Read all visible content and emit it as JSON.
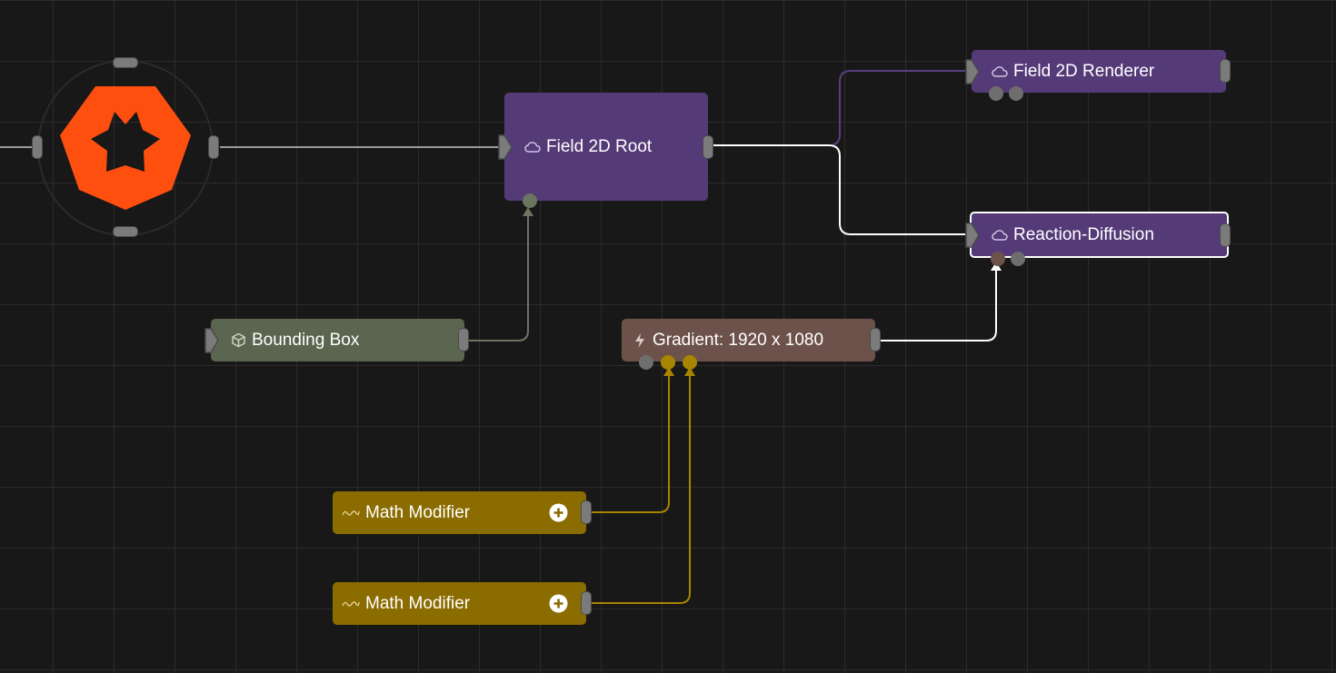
{
  "app": {
    "theme": {
      "background": "#181818",
      "grid": "#2b2b2b",
      "brand": "#ff4f0f"
    }
  },
  "root_node": {
    "icon": "brand-logo-icon"
  },
  "nodes": {
    "field_root": {
      "label": "Field 2D Root",
      "icon": "cloud-icon",
      "color": "#553a78"
    },
    "renderer": {
      "label": "Field 2D Renderer",
      "icon": "cloud-icon",
      "color": "#553a78"
    },
    "reaction": {
      "label": "Reaction-Diffusion",
      "icon": "cloud-icon",
      "color": "#553a78",
      "selected": true
    },
    "bounding": {
      "label": "Bounding Box",
      "icon": "cube-icon",
      "color": "#5b6650"
    },
    "gradient": {
      "label": "Gradient: 1920 x 1080",
      "icon": "lightning-icon",
      "color": "#6d524b"
    },
    "math1": {
      "label": "Math Modifier",
      "icon": "wave-icon",
      "action_icon": "plus-circle-icon",
      "color": "#8b6c00"
    },
    "math2": {
      "label": "Math Modifier",
      "icon": "wave-icon",
      "action_icon": "plus-circle-icon",
      "color": "#8b6c00"
    }
  },
  "links": {
    "default": "#9a9a9a",
    "selected": "#ffffff",
    "purple": "#5a3f7f",
    "bounding": "#6b7560",
    "modifier": "#a88400"
  }
}
